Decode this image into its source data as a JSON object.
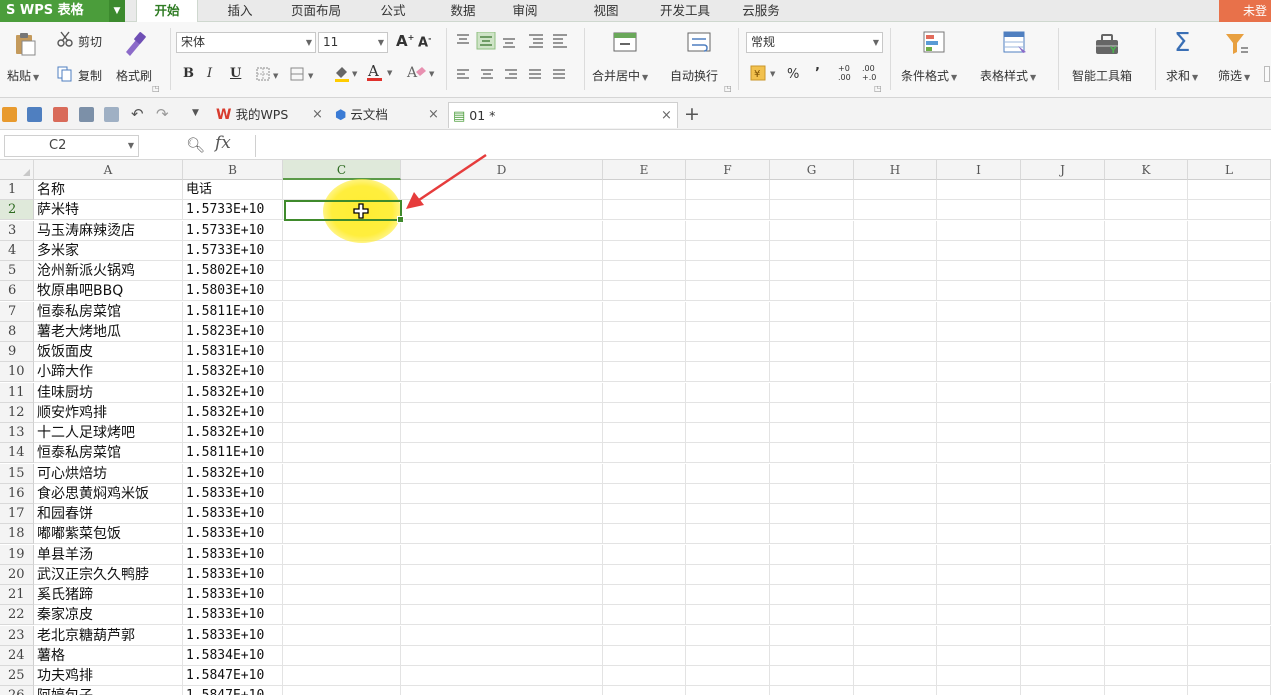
{
  "app": {
    "title": "WPS 表格",
    "login": "未登"
  },
  "menu_tabs": [
    "开始",
    "插入",
    "页面布局",
    "公式",
    "数据",
    "审阅",
    "视图",
    "开发工具",
    "云服务"
  ],
  "ribbon": {
    "paste": "粘贴",
    "cut": "剪切",
    "copy": "复制",
    "format_painter": "格式刷",
    "font_name": "宋体",
    "font_size": "11",
    "bold": "B",
    "italic": "I",
    "underline": "U",
    "merge_center": "合并居中",
    "wrap_text": "自动换行",
    "number_format": "常规",
    "percent": "%",
    "comma": "’",
    "cond_format": "条件格式",
    "table_style": "表格样式",
    "smart_toolbox": "智能工具箱",
    "sum": "求和",
    "filter": "筛选"
  },
  "doc_tabs": [
    {
      "label": "我的WPS"
    },
    {
      "label": "云文档"
    },
    {
      "label": "01 *"
    }
  ],
  "formula_bar": {
    "name_box": "C2",
    "fx": "fx",
    "value": ""
  },
  "grid": {
    "columns": [
      "A",
      "B",
      "C",
      "D",
      "E",
      "F",
      "G",
      "H",
      "I",
      "J",
      "K",
      "L"
    ],
    "selected_column": "C",
    "selected_row": 2,
    "rows": [
      {
        "n": "1",
        "a": "名称",
        "b": "电话"
      },
      {
        "n": "2",
        "a": "萨米特",
        "b": "1.5733E+10"
      },
      {
        "n": "3",
        "a": "马玉涛麻辣烫店",
        "b": "1.5733E+10"
      },
      {
        "n": "4",
        "a": "多米家",
        "b": "1.5733E+10"
      },
      {
        "n": "5",
        "a": "沧州新派火锅鸡",
        "b": "1.5802E+10"
      },
      {
        "n": "6",
        "a": "牧原串吧BBQ",
        "b": "1.5803E+10"
      },
      {
        "n": "7",
        "a": "恒泰私房菜馆",
        "b": "1.5811E+10"
      },
      {
        "n": "8",
        "a": "薯老大烤地瓜",
        "b": "1.5823E+10"
      },
      {
        "n": "9",
        "a": "饭饭面皮",
        "b": "1.5831E+10"
      },
      {
        "n": "10",
        "a": "小蹄大作",
        "b": "1.5832E+10"
      },
      {
        "n": "11",
        "a": "佳味厨坊",
        "b": "1.5832E+10"
      },
      {
        "n": "12",
        "a": "顺安炸鸡排",
        "b": "1.5832E+10"
      },
      {
        "n": "13",
        "a": "十二人足球烤吧",
        "b": "1.5832E+10"
      },
      {
        "n": "14",
        "a": "恒泰私房菜馆",
        "b": "1.5811E+10"
      },
      {
        "n": "15",
        "a": "可心烘焙坊",
        "b": "1.5832E+10"
      },
      {
        "n": "16",
        "a": "食必思黄焖鸡米饭",
        "b": "1.5833E+10"
      },
      {
        "n": "17",
        "a": "和园春饼",
        "b": "1.5833E+10"
      },
      {
        "n": "18",
        "a": "嘟嘟紫菜包饭",
        "b": "1.5833E+10"
      },
      {
        "n": "19",
        "a": "单县羊汤",
        "b": "1.5833E+10"
      },
      {
        "n": "20",
        "a": "武汉正宗久久鸭脖",
        "b": "1.5833E+10"
      },
      {
        "n": "21",
        "a": "奚氏猪蹄",
        "b": "1.5833E+10"
      },
      {
        "n": "22",
        "a": "秦家凉皮",
        "b": "1.5833E+10"
      },
      {
        "n": "23",
        "a": "老北京糖葫芦郭",
        "b": "1.5833E+10"
      },
      {
        "n": "24",
        "a": "薯格",
        "b": "1.5834E+10"
      },
      {
        "n": "25",
        "a": "功夫鸡排",
        "b": "1.5847E+10"
      },
      {
        "n": "26",
        "a": "阿婷包子",
        "b": "1.5847E+10"
      }
    ]
  },
  "colors": {
    "accent": "#4b9d3b",
    "selection": "#3f8a2c",
    "highlight": "#ffec28",
    "arrow": "#e63c3c"
  }
}
